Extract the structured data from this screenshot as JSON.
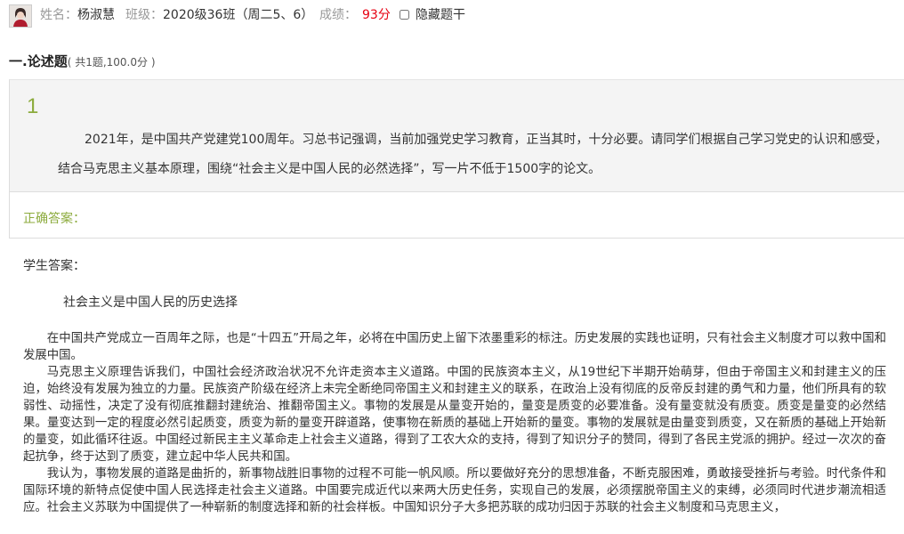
{
  "header": {
    "name_label": "姓名：",
    "name_value": "杨淑慧",
    "class_label": "班级：",
    "class_value": "2020级36班（周二5、6）",
    "score_label": "成绩：",
    "score_value": "93分",
    "hide_label": "隐藏题干"
  },
  "section": {
    "title": "一.论述题",
    "subtitle": "( 共1题,100.0分 )"
  },
  "question": {
    "number": "1",
    "line1": "2021年，是中国共产党建党100周年。习总书记强调，当前加强党史学习教育，正当其时，十分必要。请同学们根据自己学习党史的认识和感受，",
    "line2": "结合马克思主义基本原理，围绕“社会主义是中国人民的必然选择”，写一片不低于1500字的论文。"
  },
  "answer": {
    "correct_label": "正确答案：",
    "student_label": "学生答案：",
    "essay_title": "社会主义是中国人民的历史选择",
    "paragraphs": [
      "在中国共产党成立一百周年之际，也是“十四五”开局之年，必将在中国历史上留下浓墨重彩的标注。历史发展的实践也证明，只有社会主义制度才可以救中国和发展中国。",
      "马克思主义原理告诉我们，中国社会经济政治状况不允许走资本主义道路。中国的民族资本主义，从19世纪下半期开始萌芽，但由于帝国主义和封建主义的压迫，始终没有发展为独立的力量。民族资产阶级在经济上未完全断绝同帝国主义和封建主义的联系，在政治上没有彻底的反帝反封建的勇气和力量，他们所具有的软弱性、动摇性，决定了没有彻底推翻封建统治、推翻帝国主义。事物的发展是从量变开始的，量变是质变的必要准备。没有量变就没有质变。质变是量变的必然结果。量变达到一定的程度必然引起质变，质变为新的量变开辟道路，使事物在新质的基础上开始新的量变。事物的发展就是由量变到质变，又在新质的基础上开始新的量变，如此循环往返。中国经过新民主主义革命走上社会主义道路，得到了工农大众的支持，得到了知识分子的赞同，得到了各民主党派的拥护。经过一次次的奋起抗争，终于达到了质变，建立起中华人民共和国。",
      "我认为，事物发展的道路是曲折的，新事物战胜旧事物的过程不可能一帆风顺。所以要做好充分的思想准备，不断克服困难，勇敢接受挫折与考验。时代条件和国际环境的新特点促使中国人民选择走社会主义道路。中国要完成近代以来两大历史任务，实现自己的发展，必须摆脱帝国主义的束缚，必须同时代进步潮流相适应。社会主义苏联为中国提供了一种崭新的制度选择和新的社会样板。中国知识分子大多把苏联的成功归因于苏联的社会主义制度和马克思主义，"
    ]
  }
}
